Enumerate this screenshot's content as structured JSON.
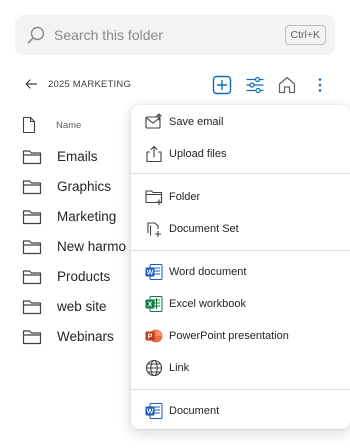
{
  "search": {
    "placeholder": "Search this folder",
    "shortcut": "Ctrl+K"
  },
  "breadcrumb": {
    "label": "2025 MARKETING"
  },
  "list": {
    "column_name": "Name",
    "items": [
      "Emails",
      "Graphics",
      "Marketing",
      "New harmo",
      "Products",
      "web site",
      "Webinars"
    ]
  },
  "menu": {
    "save_email": "Save email",
    "upload_files": "Upload files",
    "folder": "Folder",
    "document_set": "Document Set",
    "word_document": "Word document",
    "excel_workbook": "Excel workbook",
    "powerpoint_presentation": "PowerPoint presentation",
    "link": "Link",
    "document": "Document"
  },
  "colors": {
    "accent": "#0f6cbd",
    "word": "#185abd",
    "excel": "#107c41",
    "powerpoint": "#c43e1c"
  }
}
